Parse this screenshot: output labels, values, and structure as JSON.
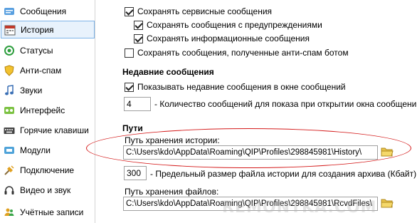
{
  "sidebar": {
    "items": [
      {
        "label": "Сообщения",
        "icon": "messages-icon"
      },
      {
        "label": "История",
        "icon": "calendar-icon",
        "active": true
      },
      {
        "label": "Статусы",
        "icon": "status-icon"
      },
      {
        "label": "Анти-спам",
        "icon": "shield-icon"
      },
      {
        "label": "Звуки",
        "icon": "music-note-icon"
      },
      {
        "label": "Интерфейс",
        "icon": "interface-icon"
      },
      {
        "label": "Горячие клавиши",
        "icon": "keyboard-icon"
      },
      {
        "label": "Модули",
        "icon": "modules-icon"
      },
      {
        "label": "Подключение",
        "icon": "connection-icon"
      },
      {
        "label": "Видео и звук",
        "icon": "headset-icon"
      },
      {
        "label": "Учётные записи",
        "icon": "accounts-icon"
      }
    ]
  },
  "options": {
    "save_service": {
      "label": "Сохранять сервисные сообщения",
      "checked": true
    },
    "save_warnings": {
      "label": "Сохранять сообщения с предупреждениями",
      "checked": true
    },
    "save_info": {
      "label": "Сохранять информационные сообщения",
      "checked": true
    },
    "save_antispam": {
      "label": "Сохранять сообщения, полученные анти-спам ботом",
      "checked": false
    }
  },
  "recent": {
    "title": "Недавние сообщения",
    "show_recent": {
      "label": "Показывать недавние сообщения в окне сообщений",
      "checked": true
    },
    "count_value": "4",
    "count_label": "- Количество сообщений для показа при открытии окна сообщений"
  },
  "paths": {
    "title": "Пути",
    "history_label": "Путь хранения истории:",
    "history_path": "C:\\Users\\kdo\\AppData\\Roaming\\QIP\\Profiles\\298845981\\History\\",
    "max_size_value": "300",
    "max_size_label": "- Предельный размер файла истории для создания архива (Кбайт)",
    "files_label": "Путь хранения файлов:",
    "files_path": "C:\\Users\\kdo\\AppData\\Roaming\\QIP\\Profiles\\298845981\\RcvdFiles\\"
  },
  "watermark": "REMONTKA.COM",
  "colors": {
    "accent": "#7db3e8",
    "highlight": "#d41a1a",
    "folder": "#e8c34a"
  }
}
